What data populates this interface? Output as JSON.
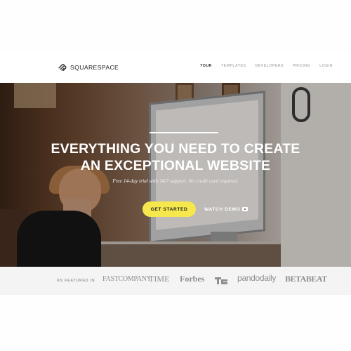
{
  "brand": {
    "logo_text": "SQUARESPACE",
    "logo_icon": "squarespace-logo-icon"
  },
  "nav": {
    "items": [
      {
        "label": "TOUR",
        "active": true
      },
      {
        "label": "TEMPLATES",
        "active": false
      },
      {
        "label": "DEVELOPERS",
        "active": false
      },
      {
        "label": "PRICING",
        "active": false
      },
      {
        "label": "LOGIN",
        "active": false
      }
    ]
  },
  "hero": {
    "headline_line1": "EVERYTHING YOU NEED TO CREATE",
    "headline_line2": "AN EXCEPTIONAL WEBSITE",
    "subtitle": "Free 14-day trial with 24/7 support. No credit card required.",
    "cta_label": "GET STARTED",
    "demo_label": "WATCH DEMO",
    "demo_icon": "play-icon"
  },
  "featured": {
    "label": "AS FEATURED IN",
    "brands": [
      "FASTCOMPANY",
      "TIME",
      "Forbes",
      "TC",
      "pandodaily",
      "BETABEAT"
    ]
  },
  "colors": {
    "cta_background": "#f6e84c",
    "nav_active": "#333333",
    "nav_inactive": "#b5b5b5"
  }
}
